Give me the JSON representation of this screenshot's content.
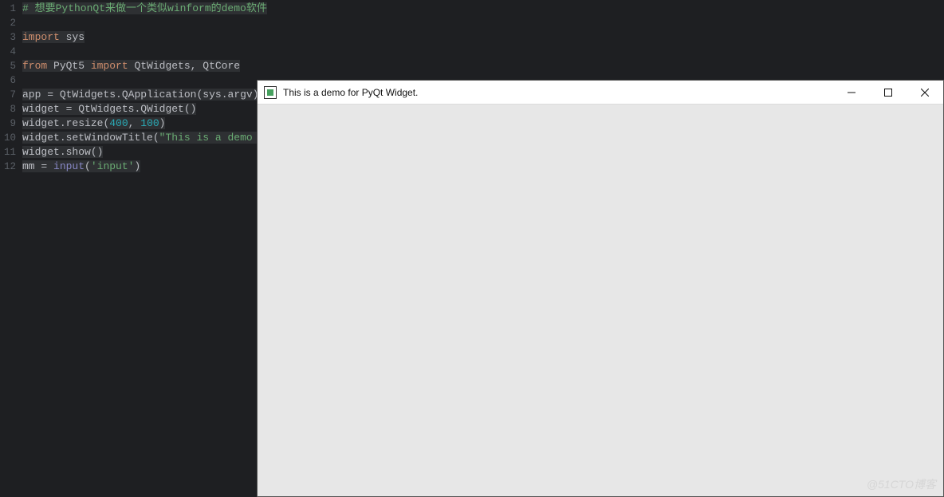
{
  "editor": {
    "lines": [
      {
        "n": 1,
        "tokens": [
          {
            "c": "tok-comment",
            "t": "# 想要PythonQt来做一个类似winform的demo软件"
          }
        ]
      },
      {
        "n": 2,
        "tokens": []
      },
      {
        "n": 3,
        "tokens": [
          {
            "c": "tok-keyword",
            "t": "import"
          },
          {
            "c": "tok-ident",
            "t": " sys"
          }
        ]
      },
      {
        "n": 4,
        "tokens": []
      },
      {
        "n": 5,
        "tokens": [
          {
            "c": "tok-keyword",
            "t": "from"
          },
          {
            "c": "tok-pkg",
            "t": " PyQt5 "
          },
          {
            "c": "tok-keyword",
            "t": "import"
          },
          {
            "c": "tok-ident",
            "t": " QtWidgets"
          },
          {
            "c": "tok-paren",
            "t": ", "
          },
          {
            "c": "tok-ident",
            "t": "QtCore"
          }
        ]
      },
      {
        "n": 6,
        "tokens": []
      },
      {
        "n": 7,
        "tokens": [
          {
            "c": "tok-ident",
            "t": "app "
          },
          {
            "c": "tok-paren",
            "t": "= "
          },
          {
            "c": "tok-ident",
            "t": "QtWidgets"
          },
          {
            "c": "tok-dot",
            "t": "."
          },
          {
            "c": "tok-ident",
            "t": "QApplication"
          },
          {
            "c": "tok-paren",
            "t": "("
          },
          {
            "c": "tok-ident",
            "t": "sys"
          },
          {
            "c": "tok-dot",
            "t": "."
          },
          {
            "c": "tok-ident",
            "t": "argv"
          },
          {
            "c": "tok-paren",
            "t": ")"
          }
        ]
      },
      {
        "n": 8,
        "tokens": [
          {
            "c": "tok-ident",
            "t": "widget "
          },
          {
            "c": "tok-paren",
            "t": "= "
          },
          {
            "c": "tok-ident",
            "t": "QtWidgets"
          },
          {
            "c": "tok-dot",
            "t": "."
          },
          {
            "c": "tok-ident",
            "t": "QWidget"
          },
          {
            "c": "tok-paren",
            "t": "()"
          }
        ]
      },
      {
        "n": 9,
        "tokens": [
          {
            "c": "tok-ident",
            "t": "widget"
          },
          {
            "c": "tok-dot",
            "t": "."
          },
          {
            "c": "tok-ident",
            "t": "resize"
          },
          {
            "c": "tok-paren",
            "t": "("
          },
          {
            "c": "tok-num",
            "t": "400"
          },
          {
            "c": "tok-paren",
            "t": ", "
          },
          {
            "c": "tok-num",
            "t": "100"
          },
          {
            "c": "tok-paren",
            "t": ")"
          }
        ]
      },
      {
        "n": 10,
        "tokens": [
          {
            "c": "tok-ident",
            "t": "widget"
          },
          {
            "c": "tok-dot",
            "t": "."
          },
          {
            "c": "tok-ident",
            "t": "setWindowTitle"
          },
          {
            "c": "tok-paren",
            "t": "("
          },
          {
            "c": "tok-str",
            "t": "\"This is a demo f"
          }
        ]
      },
      {
        "n": 11,
        "tokens": [
          {
            "c": "tok-ident",
            "t": "widget"
          },
          {
            "c": "tok-dot",
            "t": "."
          },
          {
            "c": "tok-ident",
            "t": "show"
          },
          {
            "c": "tok-paren",
            "t": "()"
          }
        ]
      },
      {
        "n": 12,
        "tokens": [
          {
            "c": "tok-ident",
            "t": "mm "
          },
          {
            "c": "tok-paren",
            "t": "= "
          },
          {
            "c": "tok-builtin",
            "t": "input"
          },
          {
            "c": "tok-paren",
            "t": "("
          },
          {
            "c": "tok-str",
            "t": "'input'"
          },
          {
            "c": "tok-paren",
            "t": ")"
          }
        ]
      }
    ]
  },
  "qt_window": {
    "title": "This is a demo for PyQt Widget."
  },
  "watermark": "@51CTO博客"
}
